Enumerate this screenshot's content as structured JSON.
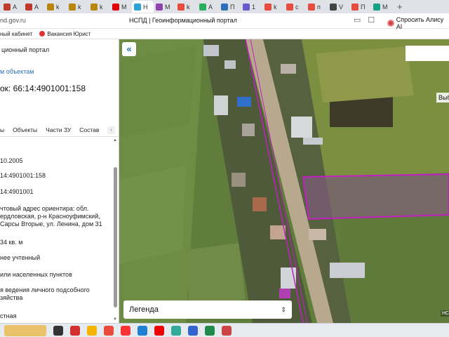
{
  "browser": {
    "tabs": [
      {
        "label": "A",
        "color": "#c0392b"
      },
      {
        "label": "A",
        "color": "#c0392b"
      },
      {
        "label": "k",
        "color": "#b8860b"
      },
      {
        "label": "k",
        "color": "#b8860b"
      },
      {
        "label": "k",
        "color": "#b8860b"
      },
      {
        "label": "M",
        "color": "#d00"
      },
      {
        "label": "H",
        "color": "#2aa3d8"
      },
      {
        "label": "M",
        "color": "#8e44ad"
      },
      {
        "label": "k",
        "color": "#e74c3c"
      },
      {
        "label": "A",
        "color": "#27ae60"
      },
      {
        "label": "П",
        "color": "#2c6fbb"
      },
      {
        "label": "1",
        "color": "#6a5acd"
      },
      {
        "label": "k",
        "color": "#e74c3c"
      },
      {
        "label": "с",
        "color": "#e74c3c"
      },
      {
        "label": "п",
        "color": "#e74c3c"
      },
      {
        "label": "V",
        "color": "#444"
      },
      {
        "label": "П",
        "color": "#e74c3c"
      },
      {
        "label": "M",
        "color": "#16a085"
      }
    ],
    "new_tab": "+",
    "url": "nd.gov.ru",
    "page_title": "НСПД | Геоинформационный портал",
    "alice_label": "Спросить Алису AI",
    "bookmarks": [
      {
        "label": "ный кабинет",
        "color": "#aaa"
      },
      {
        "label": "Вакансия Юрист",
        "color": "#d33"
      }
    ]
  },
  "sidebar": {
    "portal_title": "ционный портал",
    "objects_link": "м объектам",
    "parcel_title": "ок: 66:14:4901001:158",
    "tabs": [
      "ы",
      "Объекты",
      "Части ЗУ",
      "Состав"
    ],
    "tabs_arrow": "›",
    "rows": [
      {
        "text": "10.2005"
      },
      {
        "text": "14:4901001:158"
      },
      {
        "text": "14:4901001"
      },
      {
        "text": "чтовый адрес ориентира: обл. ердловская, р-н Красноуфимский, Сарсы Вторые, ул. Ленина, дом 31"
      },
      {
        "text": "34 кв. м"
      },
      {
        "text": "нее учтенный"
      },
      {
        "text": "или населенных пунктов"
      },
      {
        "text": "я ведения личного подсобного зяйства"
      },
      {
        "text": "стная"
      }
    ]
  },
  "map": {
    "collapse_icon": "«",
    "side_label": "Выб",
    "legend_label": "Легенда",
    "legend_chevron": "⇕",
    "badge": "НСП"
  },
  "colors": {
    "accent": "#2b6fb3",
    "parcel_outline": "#c21fc2",
    "road": "#b8a98e"
  },
  "taskbar": {
    "apps": [
      {
        "name": "start",
        "color": "#e9c26a"
      },
      {
        "name": "taskview",
        "color": "#333"
      },
      {
        "name": "app-red",
        "color": "#d32f2f"
      },
      {
        "name": "explorer",
        "color": "#f5b400"
      },
      {
        "name": "yandex-browser",
        "color": "#e84a3c"
      },
      {
        "name": "yandex",
        "color": "#f33"
      },
      {
        "name": "edge",
        "color": "#1f7fd0"
      },
      {
        "name": "opera",
        "color": "#e00"
      },
      {
        "name": "app-green",
        "color": "#3a9"
      },
      {
        "name": "app-blue",
        "color": "#3366cc"
      },
      {
        "name": "excel",
        "color": "#1f8a4c"
      },
      {
        "name": "app-grid",
        "color": "#c44"
      }
    ]
  }
}
